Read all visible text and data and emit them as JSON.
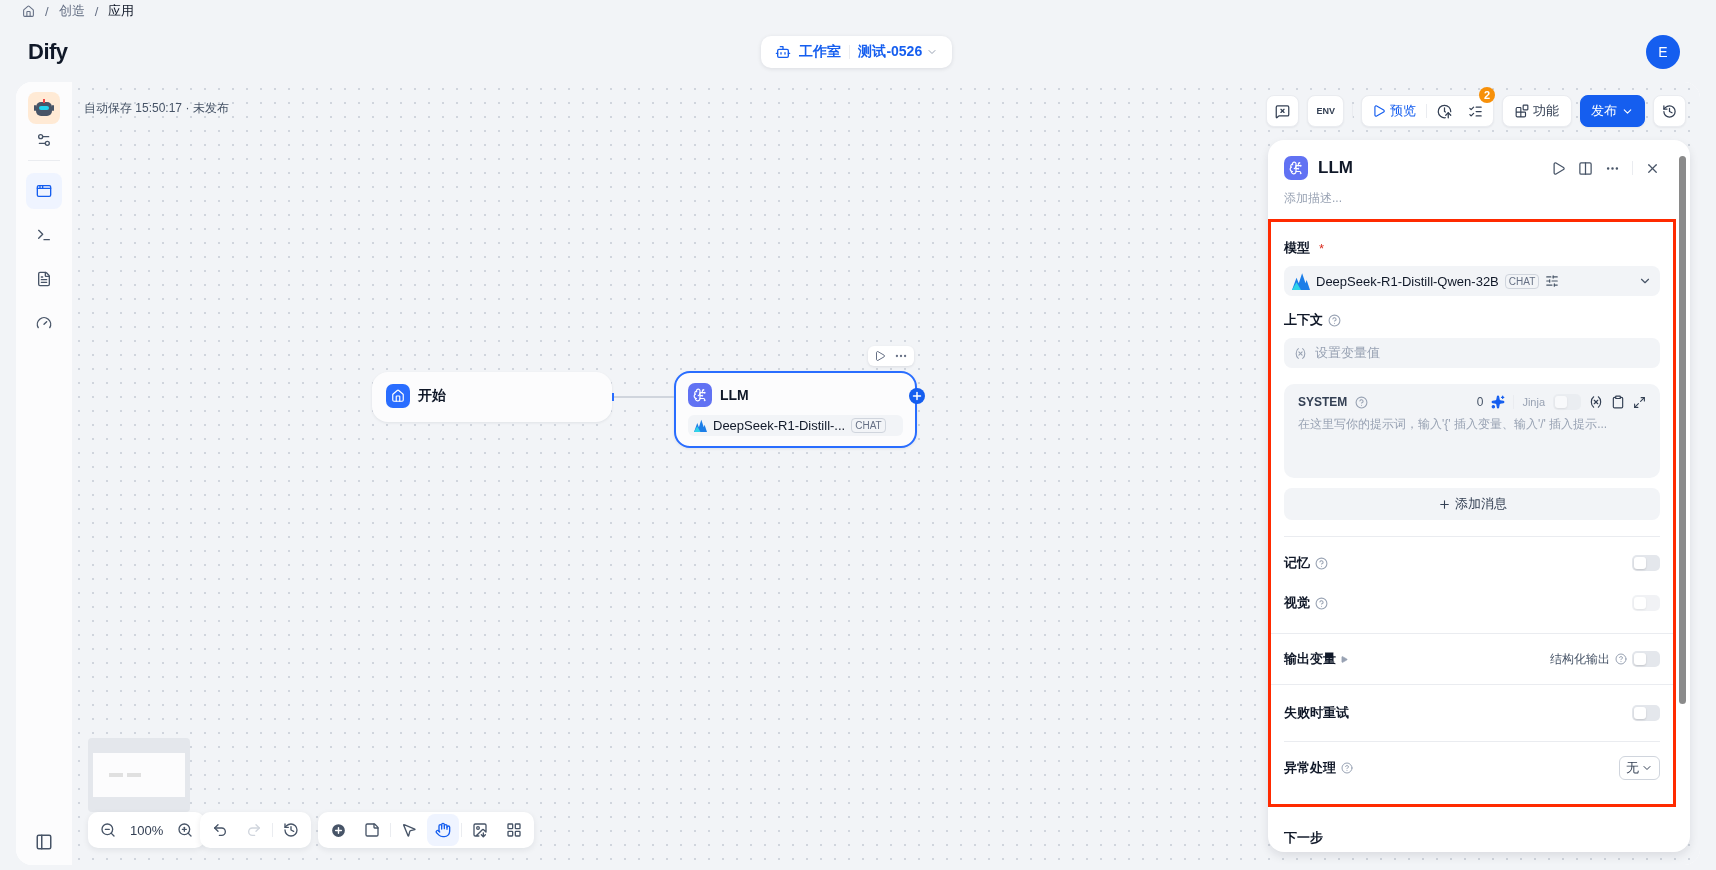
{
  "breadcrumb": [
    {
      "separator": "/",
      "label": "创造"
    },
    {
      "separator": "/",
      "label": "应用"
    }
  ],
  "header": {
    "logo": "Dify",
    "workspace": "工作室",
    "app_name": "测试-0526",
    "avatar": "E"
  },
  "sidebar": {
    "items": [
      {
        "selected": true
      },
      {
        "selected": false
      },
      {
        "selected": false
      },
      {
        "selected": false
      }
    ]
  },
  "canvas": {
    "autosave": "自动保存 15:50:17 · 未发布"
  },
  "toolbar": {
    "env": "ENV",
    "preview": "预览",
    "checklist_count": "2",
    "features": "功能",
    "publish": "发布"
  },
  "nodes": [
    {
      "kind": "start",
      "title": "开始",
      "selected": false
    },
    {
      "kind": "llm",
      "title": "LLM",
      "model": "DeepSeek-R1-Distill-...",
      "mode": "CHAT",
      "selected": true
    }
  ],
  "panel": {
    "title": "LLM",
    "description_placeholder": "添加描述...",
    "model_label": "模型",
    "required_mark": "*",
    "model": "DeepSeek-R1-Distill-Qwen-32B",
    "mode": "CHAT",
    "context_label": "上下文",
    "context_placeholder": "设置变量值",
    "prompt": {
      "role": "SYSTEM",
      "count": "0",
      "jinja_label": "Jinja",
      "jinja_on": false,
      "placeholder": "在这里写你的提示词，输入'{' 插入变量、输入'/' 插入提示..."
    },
    "add_message": "添加消息",
    "toggles": [
      {
        "label": "记忆",
        "on": false,
        "disabled": false
      },
      {
        "label": "视觉",
        "on": false,
        "disabled": true
      }
    ],
    "output": {
      "label": "输出变量",
      "structured_label": "结构化输出",
      "structured_on": false
    },
    "retry": {
      "label": "失败时重试",
      "on": false
    },
    "error_handling": {
      "label": "异常处理",
      "value": "无"
    },
    "next_step": "下一步"
  },
  "zoom": "100%",
  "canvas_modes": [
    {
      "selected": false
    },
    {
      "selected": true
    }
  ]
}
